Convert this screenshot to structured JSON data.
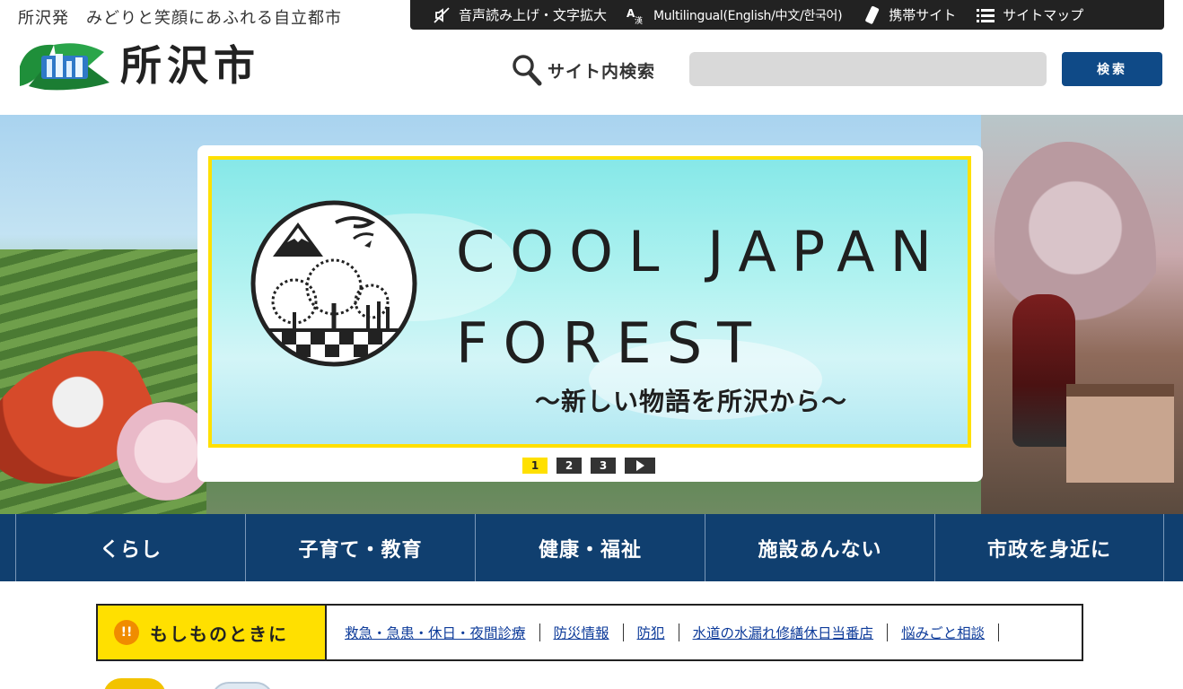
{
  "header": {
    "tagline": "所沢発　みどりと笑顔にあふれる自立都市",
    "logo_text": "所沢市",
    "topbar": [
      {
        "icon": "speaker-slash-icon",
        "label": "音声読み上げ・文字拡大"
      },
      {
        "icon": "language-icon",
        "label": "Multilingual(English/中文/한국어)"
      },
      {
        "icon": "mobile-phone-icon",
        "label": "携帯サイト"
      },
      {
        "icon": "list-icon",
        "label": "サイトマップ"
      }
    ],
    "search": {
      "label": "サイト内検索",
      "placeholder": "",
      "value": "",
      "button": "検索"
    }
  },
  "hero": {
    "banner_title": "COOL JAPAN\nFOREST",
    "banner_subtitle": "～新しい物語を所沢から～",
    "pager": [
      "1",
      "2",
      "3"
    ],
    "active_page": 0
  },
  "nav": [
    "くらし",
    "子育て・教育",
    "健康・福祉",
    "施設あんない",
    "市政を身近に"
  ],
  "emergency": {
    "title": "もしものときに",
    "alert_symbol": "!!",
    "links": [
      "救急・急患・休日・夜間診療",
      "防災情報",
      "防犯",
      "水道の水漏れ修繕休日当番店",
      "悩みごと相談"
    ]
  },
  "colors": {
    "brand_navy": "#103f6f",
    "search_button": "#0f4a87",
    "accent_yellow": "#ffe000",
    "topbar": "#222222",
    "link": "#0d3b9a"
  }
}
